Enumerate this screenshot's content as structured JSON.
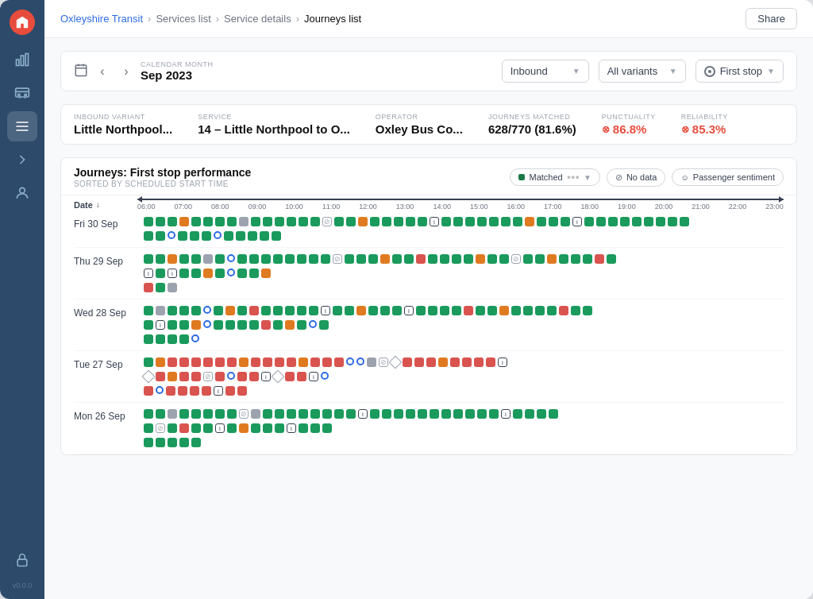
{
  "app": {
    "version": "v0.0.0"
  },
  "header": {
    "org": "Oxleyshire Transit",
    "breadcrumbs": [
      "Services list",
      "Service details",
      "Journeys list"
    ],
    "share_label": "Share"
  },
  "controls": {
    "calendar_label": "CALENDAR MONTH",
    "calendar_date": "Sep 2023",
    "inbound_label": "Inbound",
    "variants_label": "All variants",
    "first_stop_label": "First stop"
  },
  "stats": {
    "inbound_variant_label": "INBOUND VARIANT",
    "inbound_variant_value": "Little Northpool...",
    "service_label": "SERVICE",
    "service_value": "14 – Little Northpool to O...",
    "operator_label": "OPERATOR",
    "operator_value": "Oxley Bus Co...",
    "journeys_label": "JOURNEYS MATCHED",
    "journeys_value": "628/770 (81.6%)",
    "punctuality_label": "PUNCTUALITY",
    "punctuality_value": "86.8%",
    "reliability_label": "RELIABILITY",
    "reliability_value": "85.3%"
  },
  "chart": {
    "title": "Journeys: First stop performance",
    "subtitle": "SORTED BY SCHEDULED START TIME",
    "legend_matched": "Matched",
    "legend_nodata": "No data",
    "legend_sentiment": "Passenger sentiment",
    "timeline_labels": [
      "06:00",
      "07:00",
      "08:00",
      "09:00",
      "10:00",
      "11:00",
      "12:00",
      "13:00",
      "14:00",
      "15:00",
      "16:00",
      "17:00",
      "18:00",
      "19:00",
      "20:00",
      "21:00",
      "22:00",
      "23:00"
    ],
    "date_label": "Date"
  },
  "days": [
    {
      "label": "Fri 30 Sep"
    },
    {
      "label": "Thu 29 Sep"
    },
    {
      "label": "Wed 28 Sep"
    },
    {
      "label": "Tue 27 Sep"
    },
    {
      "label": "Mon 26 Sep"
    }
  ],
  "sidebar": {
    "icons": [
      "chart-bar",
      "bus",
      "list",
      "arrow-right",
      "user"
    ],
    "lock_label": "lock"
  }
}
